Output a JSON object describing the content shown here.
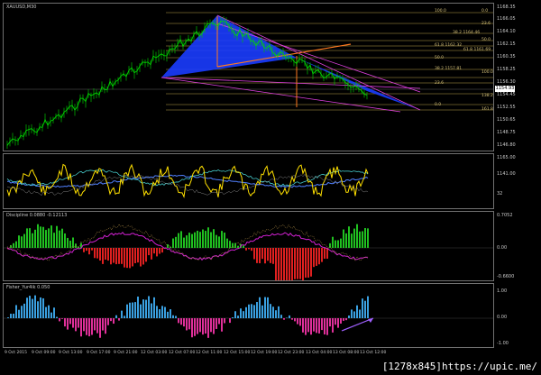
{
  "main_chart": {
    "title": "XAUUSD,M30",
    "current_price": "1154.93",
    "price_labels": [
      "1168.35",
      "1166.05",
      "1164.10",
      "1162.15",
      "1160.35",
      "1158.25",
      "1156.30",
      "1154.45",
      "1152.55",
      "1150.65",
      "1148.75",
      "1146.80"
    ],
    "fib_levels": [
      "100.0",
      "0.0",
      "23.6",
      "38.2  1164.46",
      "50.0",
      "61.8  1162.32",
      "61.8  1161.69",
      "50.0",
      "38.2  1157.81",
      "100.0",
      "23.6",
      "138.2",
      "0.0",
      "161.8"
    ]
  },
  "indicator_1": {
    "labels": [
      "1165.00",
      "1141.00",
      "32"
    ]
  },
  "indicator_2": {
    "title": "Discipline 0.0880 -0.12113",
    "labels": [
      "0.7052",
      "0.00",
      "-0.6600"
    ]
  },
  "indicator_3": {
    "title": "Fisher_Yur4ik  0.050",
    "labels": [
      "1.00",
      "0.00",
      "-1.00"
    ]
  },
  "time_axis": [
    "9 Oct 2015",
    "9 Oct 09:00",
    "9 Oct 13:00",
    "9 Oct 17:00",
    "9 Oct 21:00",
    "12 Oct 03:00",
    "12 Oct 07:00",
    "12 Oct 11:00",
    "12 Oct 15:00",
    "12 Oct 19:00",
    "12 Oct 23:00",
    "13 Oct 04:00",
    "13 Oct 08:00",
    "13 Oct 12:00"
  ],
  "watermark": "[1278x845]https://upic.me/"
}
